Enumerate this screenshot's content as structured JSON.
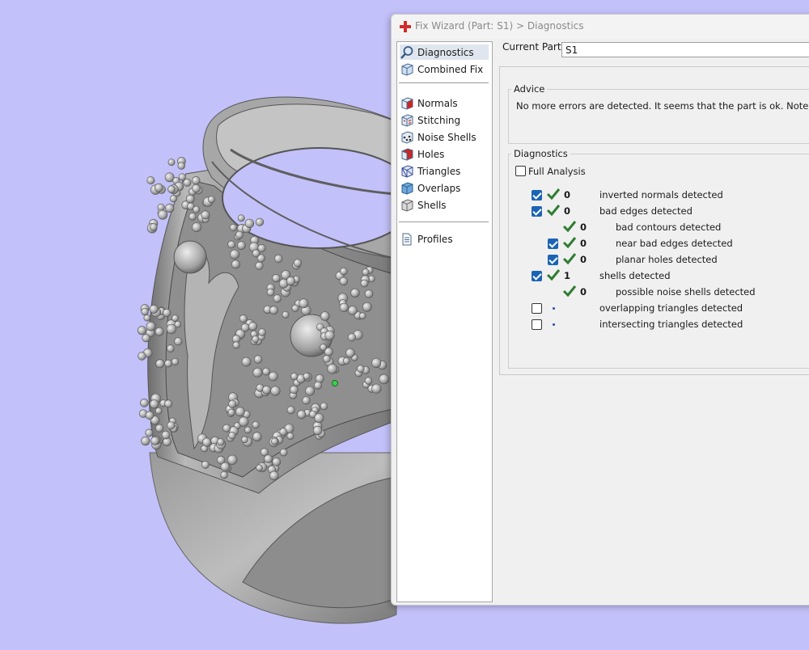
{
  "window": {
    "title": "Fix Wizard (Part: S1) > Diagnostics",
    "icon": "red-cross-icon"
  },
  "nav": {
    "items": [
      {
        "label": "Diagnostics",
        "icon": "magnifier-icon",
        "selected": true
      },
      {
        "label": "Combined Fix",
        "icon": "cube-icon"
      },
      {
        "label": "Normals",
        "icon": "normals-cube-icon"
      },
      {
        "label": "Stitching",
        "icon": "stitching-cube-icon"
      },
      {
        "label": "Noise Shells",
        "icon": "noise-shells-icon"
      },
      {
        "label": "Holes",
        "icon": "holes-cube-icon"
      },
      {
        "label": "Triangles",
        "icon": "triangles-cube-icon"
      },
      {
        "label": "Overlaps",
        "icon": "overlaps-cube-icon"
      },
      {
        "label": "Shells",
        "icon": "shells-cube-icon"
      },
      {
        "label": "Profiles",
        "icon": "profiles-document-icon"
      }
    ]
  },
  "current_part": {
    "label": "Current Part:",
    "value": "S1"
  },
  "advice": {
    "title": "Advice",
    "text": "No more errors are detected. It seems that the part is ok. Note that not all"
  },
  "diagnostics": {
    "title": "Diagnostics",
    "full_analysis": {
      "label": "Full Analysis",
      "checked": false
    },
    "rows": [
      {
        "checkbox": true,
        "checked": true,
        "status": "ok",
        "count": "0",
        "label": "inverted normals detected",
        "indent": 0
      },
      {
        "checkbox": true,
        "checked": true,
        "status": "ok",
        "count": "0",
        "label": "bad edges detected",
        "indent": 0
      },
      {
        "checkbox": false,
        "status": "ok",
        "count": "0",
        "label": "bad contours detected",
        "indent": 1
      },
      {
        "checkbox": true,
        "checked": true,
        "status": "ok",
        "count": "0",
        "label": "near bad edges detected",
        "indent": 1
      },
      {
        "checkbox": true,
        "checked": true,
        "status": "ok",
        "count": "0",
        "label": "planar holes detected",
        "indent": 1
      },
      {
        "checkbox": true,
        "checked": true,
        "status": "ok",
        "count": "1",
        "label": "shells detected",
        "indent": 0
      },
      {
        "checkbox": false,
        "status": "ok",
        "count": "0",
        "label": "possible noise shells detected",
        "indent": 1
      },
      {
        "checkbox": true,
        "checked": false,
        "status": "pending",
        "count": "",
        "label": "overlapping triangles detected",
        "indent": 0
      },
      {
        "checkbox": true,
        "checked": false,
        "status": "pending",
        "count": "",
        "label": "intersecting triangles detected",
        "indent": 0
      }
    ]
  },
  "colors": {
    "viewport_background": "#c3c1f9",
    "model": "#a9a9a9",
    "check_accent": "#1b64b5",
    "ok_tick": "#2e7d32",
    "error_red": "#d42b2b"
  }
}
